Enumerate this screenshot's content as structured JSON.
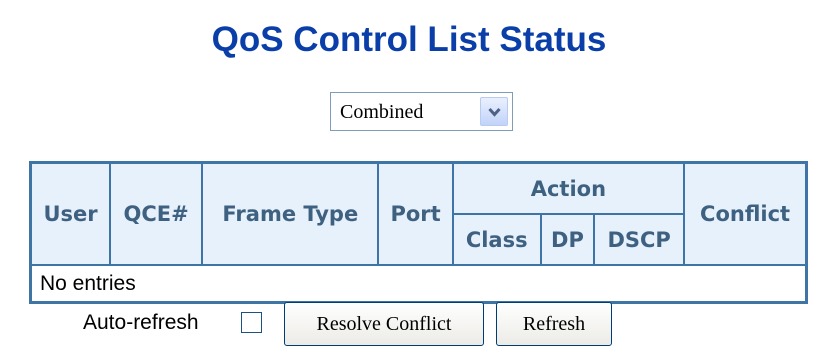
{
  "page": {
    "title": "QoS Control List Status"
  },
  "filter": {
    "selected": "Combined"
  },
  "table": {
    "headers": {
      "user": "User",
      "qce": "QCE#",
      "frame_type": "Frame Type",
      "port": "Port",
      "action": "Action",
      "class": "Class",
      "dp": "DP",
      "dscp": "DSCP",
      "conflict": "Conflict"
    },
    "empty_message": "No entries"
  },
  "controls": {
    "auto_refresh_label": "Auto-refresh",
    "auto_refresh_checked": false,
    "resolve_label": "Resolve Conflict",
    "refresh_label": "Refresh"
  },
  "colors": {
    "title": "#0a3ea8",
    "table_border": "#3f74a6",
    "header_bg": "#e7f1fb",
    "header_text": "#3f6181"
  },
  "icons": {
    "dropdown": "chevron-down-icon"
  }
}
